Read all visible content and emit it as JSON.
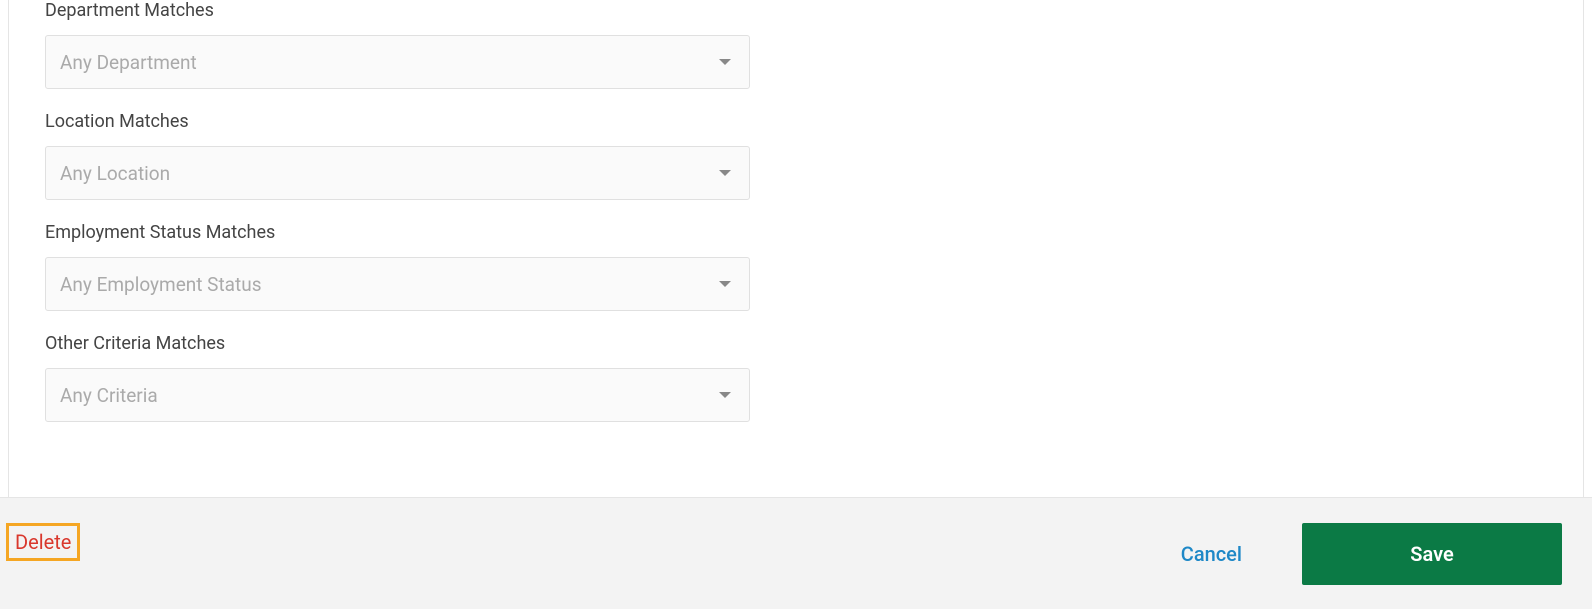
{
  "form": {
    "fields": [
      {
        "label": "Department Matches",
        "placeholder": "Any Department"
      },
      {
        "label": "Location Matches",
        "placeholder": "Any Location"
      },
      {
        "label": "Employment Status Matches",
        "placeholder": "Any Employment Status"
      },
      {
        "label": "Other Criteria Matches",
        "placeholder": "Any Criteria"
      }
    ]
  },
  "footer": {
    "delete_label": "Delete",
    "cancel_label": "Cancel",
    "save_label": "Save"
  }
}
